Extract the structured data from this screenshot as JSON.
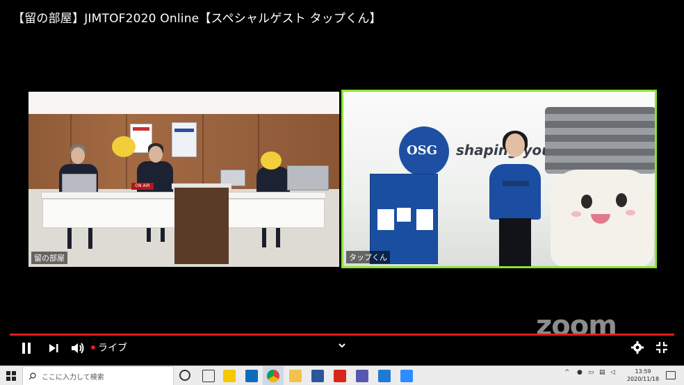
{
  "video": {
    "title": "【留の部屋】JIMTOF2020 Online【スペシャルゲスト タップくん】",
    "live_label": "ライブ",
    "watermark": "zoom",
    "accent_color": "#e01e1e",
    "active_speaker_color": "#8ae234"
  },
  "participants": [
    {
      "name": "留の部屋"
    },
    {
      "name": "タップくん"
    }
  ],
  "scene": {
    "onair_sign": "ON AIR",
    "logo_text": "OSG",
    "wall_text": "shaping you"
  },
  "controls": {
    "icons": [
      "pause-icon",
      "next-icon",
      "volume-icon",
      "chevron-down-icon",
      "gear-icon",
      "exit-fullscreen-icon"
    ]
  },
  "taskbar": {
    "search_placeholder": "ここに入力して検索",
    "time": "13:59",
    "date": "2020/11/18",
    "icons": [
      "windows-icon",
      "search-icon",
      "cortana-icon",
      "task-view-icon",
      "sticky-notes-icon",
      "outlook-icon",
      "chrome-icon",
      "file-explorer-icon",
      "word-icon",
      "acrobat-icon",
      "teams-icon",
      "photos-icon",
      "zoom-app-icon"
    ]
  }
}
